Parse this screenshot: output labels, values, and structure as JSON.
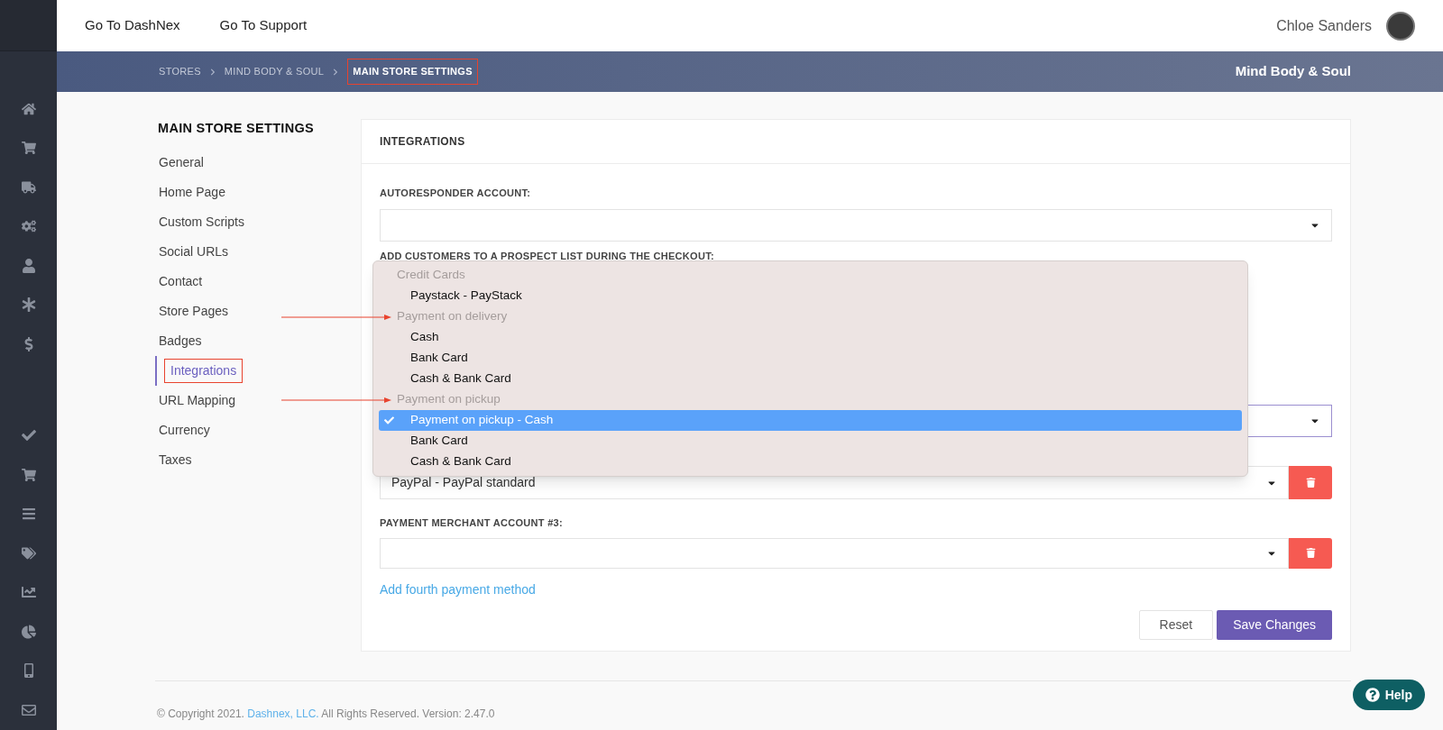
{
  "topbar": {
    "links": [
      "Go To DashNex",
      "Go To Support"
    ],
    "user_name": "Chloe Sanders"
  },
  "breadcrumb": {
    "items": [
      {
        "label": "STORES",
        "highlighted": false
      },
      {
        "label": "MIND BODY & SOUL",
        "highlighted": false
      },
      {
        "label": "MAIN STORE SETTINGS",
        "highlighted": true
      }
    ],
    "store_name": "Mind Body & Soul"
  },
  "settings_menu": {
    "title": "MAIN STORE SETTINGS",
    "items": [
      {
        "label": "General",
        "selected": false,
        "highlighted": false
      },
      {
        "label": "Home Page",
        "selected": false,
        "highlighted": false
      },
      {
        "label": "Custom Scripts",
        "selected": false,
        "highlighted": false
      },
      {
        "label": "Social URLs",
        "selected": false,
        "highlighted": false
      },
      {
        "label": "Contact",
        "selected": false,
        "highlighted": false
      },
      {
        "label": "Store Pages",
        "selected": false,
        "highlighted": false
      },
      {
        "label": "Badges",
        "selected": false,
        "highlighted": false
      },
      {
        "label": "Integrations",
        "selected": true,
        "highlighted": true
      },
      {
        "label": "URL Mapping",
        "selected": false,
        "highlighted": false
      },
      {
        "label": "Currency",
        "selected": false,
        "highlighted": false
      },
      {
        "label": "Taxes",
        "selected": false,
        "highlighted": false
      }
    ]
  },
  "card": {
    "title": "INTEGRATIONS",
    "autoresponder_label": "AUTORESPONDER ACCOUNT:",
    "prospect_label": "ADD CUSTOMERS TO A PROSPECT LIST DURING THE CHECKOUT:",
    "merchant_2_value": "PayPal - PayPal standard",
    "merchant_3_label": "PAYMENT MERCHANT ACCOUNT #3:",
    "add_link": "Add fourth payment method",
    "buttons": [
      "Reset",
      "Save Changes"
    ]
  },
  "dropdown": {
    "options": [
      {
        "kind": "group",
        "label": "Credit Cards",
        "annotated": false
      },
      {
        "kind": "option",
        "label": "Paystack - PayStack",
        "selected": false
      },
      {
        "kind": "group",
        "label": "Payment on delivery",
        "annotated": true
      },
      {
        "kind": "option",
        "label": "Cash",
        "selected": false
      },
      {
        "kind": "option",
        "label": "Bank Card",
        "selected": false
      },
      {
        "kind": "option",
        "label": "Cash & Bank Card",
        "selected": false
      },
      {
        "kind": "group",
        "label": "Payment on pickup",
        "annotated": true
      },
      {
        "kind": "option",
        "label": "Payment on pickup - Cash",
        "selected": true
      },
      {
        "kind": "option",
        "label": "Bank Card",
        "selected": false
      },
      {
        "kind": "option",
        "label": "Cash & Bank Card",
        "selected": false
      }
    ]
  },
  "footer": {
    "prefix": "© Copyright 2021.",
    "company": "Dashnex, LLC.",
    "suffix": "All Rights Reserved. Version: 2.47.0"
  },
  "help_button": "Help"
}
